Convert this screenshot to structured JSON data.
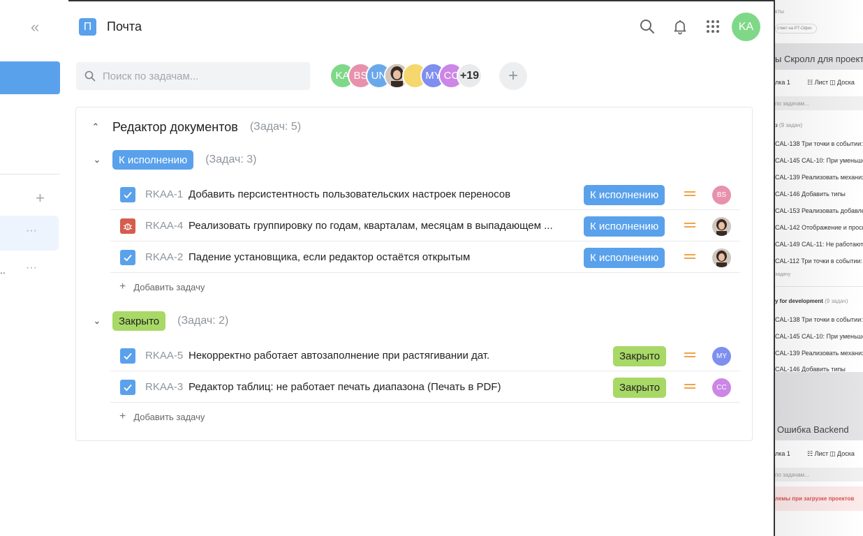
{
  "sidebar": {
    "collapse_icon": "«",
    "add_icon": "+",
    "more_icon": "···",
    "truncated_item": ".."
  },
  "header": {
    "app_icon_letter": "П",
    "app_title": "Почта",
    "user_initials": "KA",
    "icons": [
      "search-icon",
      "bell-icon",
      "apps-grid-icon"
    ]
  },
  "search": {
    "placeholder": "Поиск по задачам..."
  },
  "members": {
    "avatars": [
      {
        "label": "KA",
        "color": "#7fd888"
      },
      {
        "label": "BS",
        "color": "#e891ac"
      },
      {
        "label": "UN",
        "color": "#6aa8ec"
      },
      {
        "label": "",
        "color": "#9b6b55",
        "photo": true
      },
      {
        "label": "",
        "color": "#f5d76e"
      },
      {
        "label": "MY",
        "color": "#7e8ff0"
      },
      {
        "label": "CC",
        "color": "#cc86e6"
      }
    ],
    "more": "+19",
    "add_icon": "+"
  },
  "project": {
    "name": "Редактор документов",
    "count": "(Задач: 5)",
    "groups": [
      {
        "status": "К исполнению",
        "count": "(Задач: 3)",
        "tasks": [
          {
            "key": "RKAA-1",
            "title": "Добавить персистентность пользовательских настроек переносов",
            "status": "К исполнению",
            "type": "task",
            "assignee": "BS"
          },
          {
            "key": "RKAA-4",
            "title": "Реализовать группировку по годам, кварталам, месяцам в выпадающем ...",
            "status": "К исполнению",
            "type": "bug",
            "assignee": ""
          },
          {
            "key": "RKAA-2",
            "title": "Падение установщика, если редактор остаётся открытым",
            "status": "К исполнению",
            "type": "task",
            "assignee": ""
          }
        ],
        "add_label": "Добавить задачу"
      },
      {
        "status": "Закрыто",
        "count": "(Задач: 2)",
        "tasks": [
          {
            "key": "RKAA-5",
            "title": "Некорректно работает автозаполнение при растягивании дат.",
            "status": "Закрыто",
            "type": "task",
            "assignee": "MY"
          },
          {
            "key": "RKAA-3",
            "title": "Редактор таблиц: не работает печать диапазона (Печать в PDF)",
            "status": "Закрыто",
            "type": "task",
            "assignee": "CC"
          }
        ],
        "add_label": "Добавить задачу"
      }
    ]
  },
  "background_window": {
    "top_text": "кты",
    "pill_text": "ствет на Р7-Офис",
    "section1_title": "ы Скролл для проект",
    "tab_a": "лка 1",
    "tab_list": "☷ Лист",
    "tab_board": "◫ Доска",
    "search_hint": "по задачам...",
    "group1": "з",
    "group1_count": "(9 задач)",
    "rows1": [
      "CAL-138  Три точки в событии: С",
      "CAL-145  CAL-10: При уменьшени",
      "CAL-139  Реализовать механизм",
      "CAL-146  Добавить типы",
      "CAL-153  Реализовать добавлен",
      "CAL-142  Отображение и просмо",
      "CAL-149  CAL-11: Не работают ин",
      "CAL-112  Три точки в событии: С"
    ],
    "add_short": "задачу",
    "group2": "y for development",
    "group2_count": "(9 задач)",
    "rows2": [
      "CAL-138  Три точки в событии: С",
      "CAL-145  CAL-10: При уменьшени",
      "CAL-139  Реализовать механизм",
      "CAL-146  Добавить типы"
    ],
    "section2_title": "Ошибка Backend",
    "problem_text": "лемы при загрузке проектов"
  }
}
